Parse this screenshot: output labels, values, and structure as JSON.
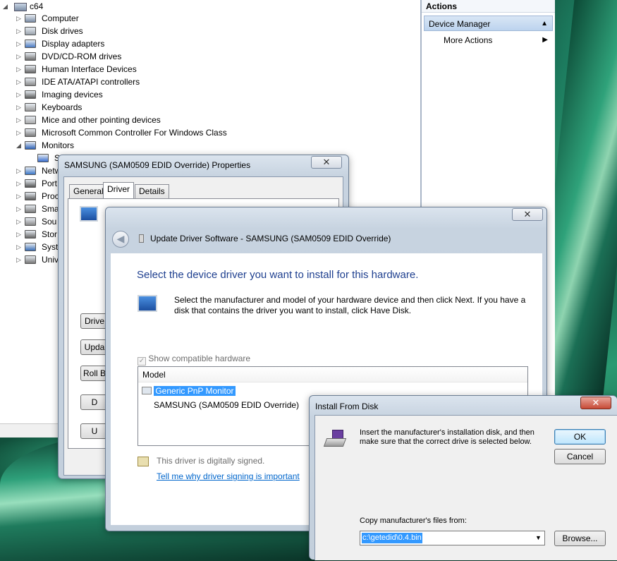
{
  "device_manager": {
    "root": "c64",
    "items": [
      {
        "label": "Computer",
        "expander": "▷"
      },
      {
        "label": "Disk drives",
        "expander": "▷"
      },
      {
        "label": "Display adapters",
        "expander": "▷"
      },
      {
        "label": "DVD/CD-ROM drives",
        "expander": "▷"
      },
      {
        "label": "Human Interface Devices",
        "expander": "▷"
      },
      {
        "label": "IDE ATA/ATAPI controllers",
        "expander": "▷"
      },
      {
        "label": "Imaging devices",
        "expander": "▷"
      },
      {
        "label": "Keyboards",
        "expander": "▷"
      },
      {
        "label": "Mice and other pointing devices",
        "expander": "▷"
      },
      {
        "label": "Microsoft Common Controller For Windows Class",
        "expander": "▷"
      },
      {
        "label": "Monitors",
        "expander": "◢"
      },
      {
        "label": "S",
        "expander": ""
      },
      {
        "label": "Netw",
        "expander": "▷"
      },
      {
        "label": "Port",
        "expander": "▷"
      },
      {
        "label": "Proc",
        "expander": "▷"
      },
      {
        "label": "Sma",
        "expander": "▷"
      },
      {
        "label": "Sou",
        "expander": "▷"
      },
      {
        "label": "Stor",
        "expander": "▷"
      },
      {
        "label": "Syst",
        "expander": "▷"
      },
      {
        "label": "Univ",
        "expander": "▷"
      }
    ]
  },
  "actions": {
    "header": "Actions",
    "section": "Device Manager",
    "more": "More Actions",
    "up_arrow": "▲",
    "right_arrow": "▶"
  },
  "properties_dialog": {
    "title": "SAMSUNG (SAM0509 EDID Override) Properties",
    "close": "✕",
    "tabs": [
      "General",
      "Driver",
      "Details"
    ],
    "buttons": [
      "Drive",
      "Upda",
      "Roll B",
      "D",
      "U"
    ]
  },
  "update_driver": {
    "title": "Update Driver Software - SAMSUNG (SAM0509 EDID Override)",
    "close": "✕",
    "heading": "Select the device driver you want to install for this hardware.",
    "description": "Select the manufacturer and model of your hardware device and then click Next. If you have a disk that contains the driver you want to install, click Have Disk.",
    "show_compatible": "Show compatible hardware",
    "model_header": "Model",
    "models": [
      "Generic PnP Monitor",
      "SAMSUNG (SAM0509 EDID Override)"
    ],
    "signed_text": "This driver is digitally signed.",
    "signing_link": "Tell me why driver signing is important"
  },
  "install_from_disk": {
    "title": "Install From Disk",
    "close": "✕",
    "message": "Insert the manufacturer's installation disk, and then make sure that the correct drive is selected below.",
    "ok": "OK",
    "cancel": "Cancel",
    "copy_label": "Copy manufacturer's files from:",
    "path_value": "c:\\getedid\\0.4.bin",
    "browse": "Browse...",
    "dropdown_arrow": "▼"
  }
}
